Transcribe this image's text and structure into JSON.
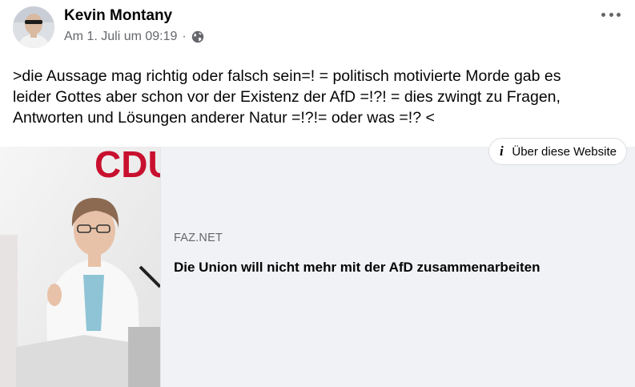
{
  "post": {
    "author": "Kevin Montany",
    "timestamp": "Am 1. Juli um 09:19",
    "separator": "·",
    "privacy_icon": "globe-icon",
    "more_icon": "more-icon",
    "text_lines": [
      ">die Aussage mag richtig oder falsch sein=! = politisch motivierte Morde gab es",
      "leider Gottes aber schon vor der Existenz der AfD =!?! = dies zwingt zu Fragen,",
      "Antworten und Lösungen anderer Natur =!?!= oder was =!? <"
    ]
  },
  "link_card": {
    "about_label": "Über diese Website",
    "about_icon": "info-icon",
    "domain": "FAZ.NET",
    "title": "Die Union will nicht mehr mit der AfD zusammenarbeiten",
    "image_text": "CDU",
    "accent_color": "#c8102e"
  }
}
